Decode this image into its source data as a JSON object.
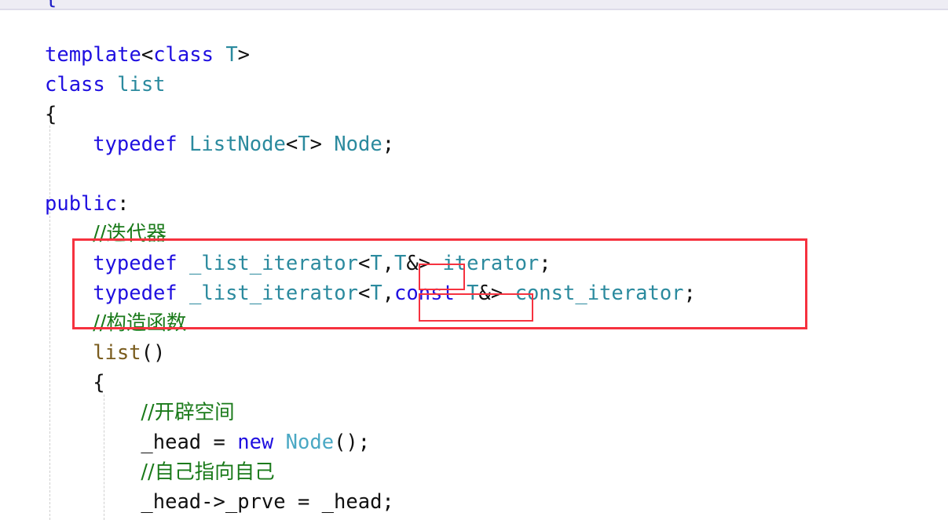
{
  "editor": {
    "language": "cpp",
    "top_partial_line": "{",
    "background_color": "#ffffff",
    "top_strip_color": "#eeedf4",
    "indent_guide_color": "#cfcfcf"
  },
  "colors": {
    "keyword": "#1f0fe0",
    "type": "#2b8a9e",
    "type_light": "#4aa8c4",
    "comment": "#1a7a1a",
    "function": "#7a5c1e",
    "plain": "#101010",
    "annotation_red": "#f6323f"
  },
  "code": {
    "lines": [
      {
        "indent": 0,
        "segments": [
          {
            "text": "template",
            "kind": "keyword"
          },
          {
            "text": "<",
            "kind": "plain"
          },
          {
            "text": "class",
            "kind": "keyword"
          },
          {
            "text": " ",
            "kind": "plain"
          },
          {
            "text": "T",
            "kind": "type"
          },
          {
            "text": ">",
            "kind": "plain"
          }
        ],
        "plain_text": "template<class T>"
      },
      {
        "indent": 0,
        "segments": [
          {
            "text": "class",
            "kind": "keyword"
          },
          {
            "text": " ",
            "kind": "plain"
          },
          {
            "text": "list",
            "kind": "type"
          }
        ],
        "plain_text": "class list"
      },
      {
        "indent": 0,
        "segments": [
          {
            "text": "{",
            "kind": "plain"
          }
        ],
        "plain_text": "{"
      },
      {
        "indent": 1,
        "segments": [
          {
            "text": "typedef",
            "kind": "keyword"
          },
          {
            "text": " ",
            "kind": "plain"
          },
          {
            "text": "ListNode",
            "kind": "type"
          },
          {
            "text": "<",
            "kind": "plain"
          },
          {
            "text": "T",
            "kind": "type"
          },
          {
            "text": ">",
            "kind": "plain"
          },
          {
            "text": " ",
            "kind": "plain"
          },
          {
            "text": "Node",
            "kind": "type"
          },
          {
            "text": ";",
            "kind": "plain"
          }
        ],
        "plain_text": "typedef ListNode<T> Node;"
      },
      {
        "indent": 0,
        "segments": [],
        "plain_text": ""
      },
      {
        "indent": 0,
        "segments": [
          {
            "text": "public",
            "kind": "keyword"
          },
          {
            "text": ":",
            "kind": "plain"
          }
        ],
        "plain_text": "public:"
      },
      {
        "indent": 1,
        "segments": [
          {
            "text": "//迭代器",
            "kind": "comment"
          }
        ],
        "plain_text": "//迭代器"
      },
      {
        "indent": 1,
        "segments": [
          {
            "text": "typedef",
            "kind": "keyword"
          },
          {
            "text": " ",
            "kind": "plain"
          },
          {
            "text": "_list_iterator",
            "kind": "type"
          },
          {
            "text": "<",
            "kind": "plain"
          },
          {
            "text": "T",
            "kind": "type"
          },
          {
            "text": ",",
            "kind": "plain"
          },
          {
            "text": "T",
            "kind": "type"
          },
          {
            "text": "&>",
            "kind": "plain"
          },
          {
            "text": " ",
            "kind": "plain"
          },
          {
            "text": "iterator",
            "kind": "type"
          },
          {
            "text": ";",
            "kind": "plain"
          }
        ],
        "plain_text": "typedef _list_iterator<T,T&> iterator;"
      },
      {
        "indent": 1,
        "segments": [
          {
            "text": "typedef",
            "kind": "keyword"
          },
          {
            "text": " ",
            "kind": "plain"
          },
          {
            "text": "_list_iterator",
            "kind": "type"
          },
          {
            "text": "<",
            "kind": "plain"
          },
          {
            "text": "T",
            "kind": "type"
          },
          {
            "text": ",",
            "kind": "plain"
          },
          {
            "text": "const",
            "kind": "keyword"
          },
          {
            "text": " ",
            "kind": "plain"
          },
          {
            "text": "T",
            "kind": "type"
          },
          {
            "text": "&>",
            "kind": "plain"
          },
          {
            "text": " ",
            "kind": "plain"
          },
          {
            "text": "const_iterator",
            "kind": "type"
          },
          {
            "text": ";",
            "kind": "plain"
          }
        ],
        "plain_text": "typedef _list_iterator<T,const T&> const_iterator;"
      },
      {
        "indent": 1,
        "segments": [
          {
            "text": "//构造函数",
            "kind": "comment"
          }
        ],
        "plain_text": "//构造函数"
      },
      {
        "indent": 1,
        "segments": [
          {
            "text": "list",
            "kind": "function"
          },
          {
            "text": "()",
            "kind": "plain"
          }
        ],
        "plain_text": "list()"
      },
      {
        "indent": 1,
        "segments": [
          {
            "text": "{",
            "kind": "plain"
          }
        ],
        "plain_text": "{"
      },
      {
        "indent": 2,
        "segments": [
          {
            "text": "//开辟空间",
            "kind": "comment"
          }
        ],
        "plain_text": "//开辟空间"
      },
      {
        "indent": 2,
        "segments": [
          {
            "text": "_head = ",
            "kind": "plain"
          },
          {
            "text": "new",
            "kind": "keyword"
          },
          {
            "text": " ",
            "kind": "plain"
          },
          {
            "text": "Node",
            "kind": "type_light"
          },
          {
            "text": "();",
            "kind": "plain"
          }
        ],
        "plain_text": "_head = new Node();"
      },
      {
        "indent": 2,
        "segments": [
          {
            "text": "//自己指向自己",
            "kind": "comment"
          }
        ],
        "plain_text": "//自己指向自己"
      },
      {
        "indent": 2,
        "segments": [
          {
            "text": "_head->_prve = _head;",
            "kind": "plain"
          }
        ],
        "plain_text": "_head->_prve = _head;"
      }
    ]
  },
  "annotations": {
    "outer_box": {
      "label": "iterator-typedefs-highlight",
      "covers": "//迭代器 and both _list_iterator typedef lines",
      "color": "#f6323f"
    },
    "inner_box_1": {
      "label": "t-reference-highlight",
      "covers": "T&>",
      "color": "#f6323f"
    },
    "inner_box_2": {
      "label": "const-t-reference-highlight",
      "covers": "const T&",
      "color": "#f6323f"
    }
  }
}
